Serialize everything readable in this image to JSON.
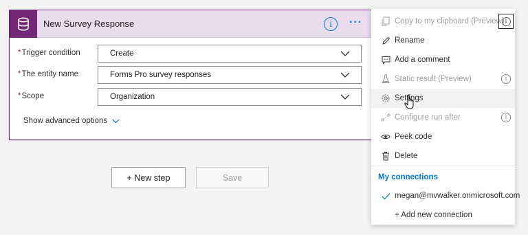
{
  "card": {
    "title": "New Survey Response",
    "accent_color": "#742774",
    "header_color": "#e9dcef",
    "info_icon": "info-icon",
    "more_icon": "ellipsis-icon",
    "fields": [
      {
        "label": "Trigger condition",
        "required_mark": "*",
        "value": "Create"
      },
      {
        "label": "The entity name",
        "required_mark": "*",
        "value": "Forms Pro survey responses"
      },
      {
        "label": "Scope",
        "required_mark": "*",
        "value": "Organization"
      }
    ],
    "advanced_label": "Show advanced options"
  },
  "actions": {
    "new_step_label": "+ New step",
    "save_label": "Save"
  },
  "menu": {
    "items": [
      {
        "label": "Copy to my clipboard (Preview)",
        "icon": "copy-icon",
        "disabled": true
      },
      {
        "label": "Rename",
        "icon": "pencil-icon",
        "disabled": false
      },
      {
        "label": "Add a comment",
        "icon": "comment-icon",
        "disabled": false
      },
      {
        "label": "Static result (Preview)",
        "icon": "flask-icon",
        "disabled": true
      },
      {
        "label": "Settings",
        "icon": "gear-icon",
        "disabled": false
      },
      {
        "label": "Configure run after",
        "icon": "run-after-icon",
        "disabled": true
      },
      {
        "label": "Peek code",
        "icon": "eye-icon",
        "disabled": false
      },
      {
        "label": "Delete",
        "icon": "trash-icon",
        "disabled": false
      }
    ],
    "connections_heading": "My connections",
    "connection_account": "megan@mvwalker.onmicrosoft.com",
    "add_connection_label": "+ Add new connection",
    "link_color": "#0078d4"
  }
}
